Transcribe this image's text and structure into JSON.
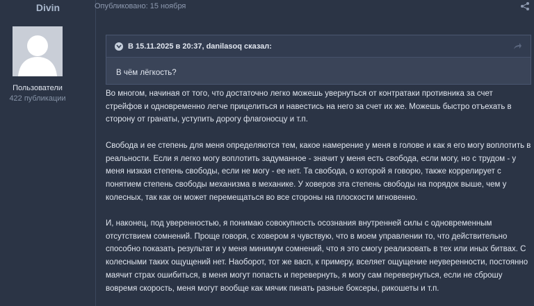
{
  "author": {
    "name": "Divin",
    "group": "Пользователи",
    "posts": "422 публикации"
  },
  "post": {
    "published": "Опубликовано: 15 ноября"
  },
  "quote": {
    "header": "В 15.11.2025 в 20:37, danilasoq сказал:",
    "text": "В чём лёгкость?"
  },
  "paragraphs": [
    "Во многом, начиная от того, что достаточно легко можешь увернуться от контратаки противника за счет стрейфов и одновременно легче прицелиться и навестись на него за счет их же. Можешь быстро отъехать в сторону от гранаты, уступить дорогу флагоносцу и т.п.",
    "Свобода и ее степень для меня определяются тем, какое намерение у меня в голове и как я его могу воплотить в реальности.  Если я легко могу воплотить задуманное - значит у меня есть свобода, если могу, но с трудом - у меня низкая степень свободы, если не могу - ее нет. Та свобода, о которой я говорю, также коррелирует с понятием степень свободы механизма в механике. У ховеров эта степень свободы на порядок выше, чем у колесных, так как он может перемещаться во все стороны на плоскости мгновенно.",
    "И, наконец, под уверенностью, я понимаю совокупность  осознания внутренней силы с одновременным отсутствием сомнений. Проще говоря, с ховером я чувствую, что в моем управлении то, что действительно способно показать результат и у меня минимум сомнений, что я это смогу реализовать в тех или иных битвах. С колесными таких ощущений нет. Наоборот, тот же васп, к примеру, вселяет ощущение неуверенности, постоянно маячит страх ошибиться, в меня могут попасть и перевернуть, я могу сам перевернуться, если не сброшу вовремя скорость, меня могут вообще как мячик пинать разные боксеры, рикошеты и т.п."
  ],
  "icons": {
    "share": "share-icon",
    "collapse": "chevron-down-icon",
    "goto": "goto-post-icon",
    "avatar": "default-avatar-icon"
  },
  "colors": {
    "background": "#2b3445",
    "quote_bg": "#3a4458",
    "text": "#e1e6ef",
    "muted": "#8e9ab0"
  }
}
